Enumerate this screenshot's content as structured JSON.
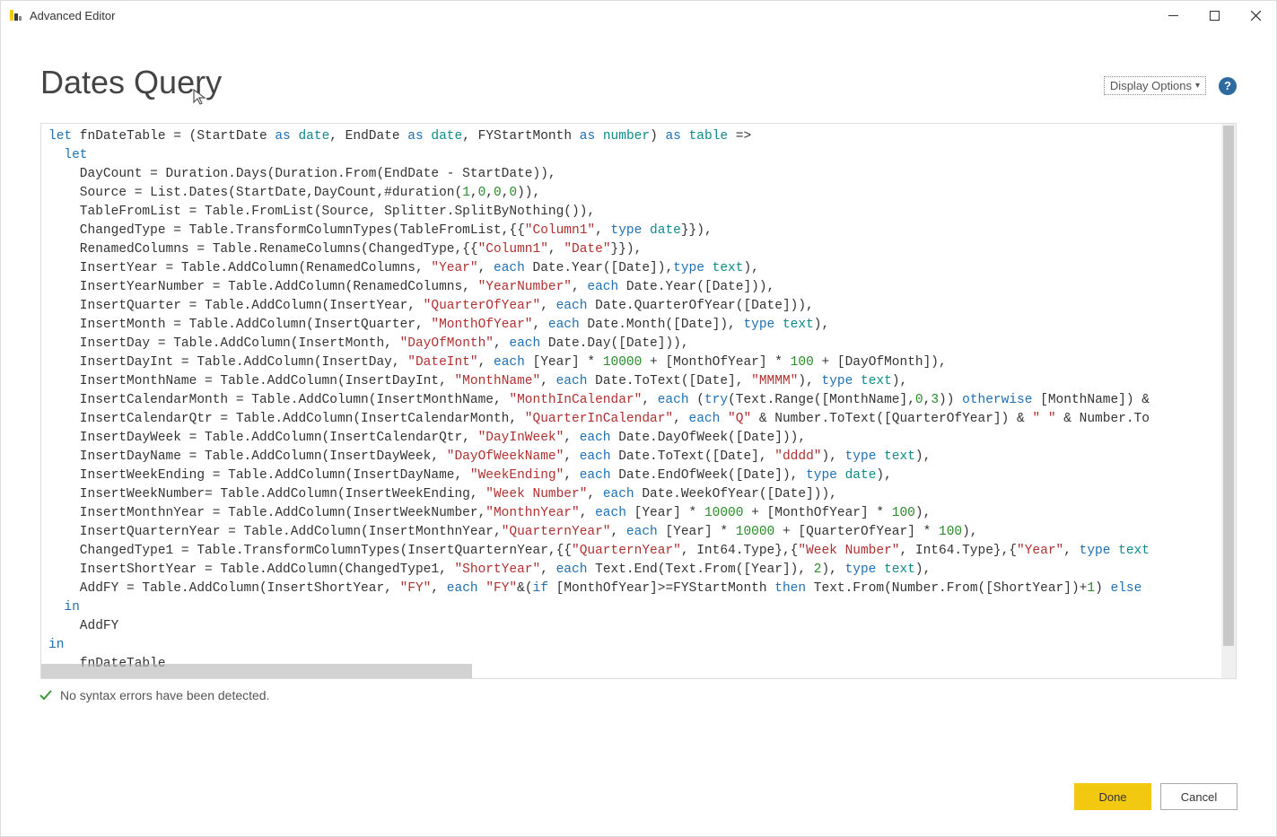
{
  "window": {
    "title": "Advanced Editor",
    "min": "Minimize",
    "max": "Maximize",
    "close": "Close"
  },
  "header": {
    "title": "Dates Query",
    "display_options": "Display Options",
    "help": "?"
  },
  "status": {
    "message": "No syntax errors have been detected."
  },
  "footer": {
    "done": "Done",
    "cancel": "Cancel"
  },
  "code": {
    "lines": [
      [
        [
          "kw",
          "let"
        ],
        [
          "id",
          " fnDateTable = (StartDate "
        ],
        [
          "kw",
          "as"
        ],
        [
          "id",
          " "
        ],
        [
          "ty",
          "date"
        ],
        [
          "id",
          ", EndDate "
        ],
        [
          "kw",
          "as"
        ],
        [
          "id",
          " "
        ],
        [
          "ty",
          "date"
        ],
        [
          "id",
          ", FYStartMonth "
        ],
        [
          "kw",
          "as"
        ],
        [
          "id",
          " "
        ],
        [
          "ty",
          "number"
        ],
        [
          "id",
          ") "
        ],
        [
          "kw",
          "as"
        ],
        [
          "id",
          " "
        ],
        [
          "ty",
          "table"
        ],
        [
          "id",
          " =>"
        ]
      ],
      [
        [
          "id",
          "  "
        ],
        [
          "kw",
          "let"
        ]
      ],
      [
        [
          "id",
          "    DayCount = Duration.Days(Duration.From(EndDate - StartDate)),"
        ]
      ],
      [
        [
          "id",
          "    Source = List.Dates(StartDate,DayCount,#duration("
        ],
        [
          "num",
          "1"
        ],
        [
          "id",
          ","
        ],
        [
          "num",
          "0"
        ],
        [
          "id",
          ","
        ],
        [
          "num",
          "0"
        ],
        [
          "id",
          ","
        ],
        [
          "num",
          "0"
        ],
        [
          "id",
          ")),"
        ]
      ],
      [
        [
          "id",
          "    TableFromList = Table.FromList(Source, Splitter.SplitByNothing()),"
        ]
      ],
      [
        [
          "id",
          "    ChangedType = Table.TransformColumnTypes(TableFromList,{{"
        ],
        [
          "str",
          "\"Column1\""
        ],
        [
          "id",
          ", "
        ],
        [
          "kw",
          "type"
        ],
        [
          "id",
          " "
        ],
        [
          "ty",
          "date"
        ],
        [
          "id",
          "}}),"
        ]
      ],
      [
        [
          "id",
          "    RenamedColumns = Table.RenameColumns(ChangedType,{{"
        ],
        [
          "str",
          "\"Column1\""
        ],
        [
          "id",
          ", "
        ],
        [
          "str",
          "\"Date\""
        ],
        [
          "id",
          "}}),"
        ]
      ],
      [
        [
          "id",
          "    InsertYear = Table.AddColumn(RenamedColumns, "
        ],
        [
          "str",
          "\"Year\""
        ],
        [
          "id",
          ", "
        ],
        [
          "kw",
          "each"
        ],
        [
          "id",
          " Date.Year([Date]),"
        ],
        [
          "kw",
          "type"
        ],
        [
          "id",
          " "
        ],
        [
          "ty",
          "text"
        ],
        [
          "id",
          "),"
        ]
      ],
      [
        [
          "id",
          "    InsertYearNumber = Table.AddColumn(RenamedColumns, "
        ],
        [
          "str",
          "\"YearNumber\""
        ],
        [
          "id",
          ", "
        ],
        [
          "kw",
          "each"
        ],
        [
          "id",
          " Date.Year([Date])),"
        ]
      ],
      [
        [
          "id",
          "    InsertQuarter = Table.AddColumn(InsertYear, "
        ],
        [
          "str",
          "\"QuarterOfYear\""
        ],
        [
          "id",
          ", "
        ],
        [
          "kw",
          "each"
        ],
        [
          "id",
          " Date.QuarterOfYear([Date])),"
        ]
      ],
      [
        [
          "id",
          "    InsertMonth = Table.AddColumn(InsertQuarter, "
        ],
        [
          "str",
          "\"MonthOfYear\""
        ],
        [
          "id",
          ", "
        ],
        [
          "kw",
          "each"
        ],
        [
          "id",
          " Date.Month([Date]), "
        ],
        [
          "kw",
          "type"
        ],
        [
          "id",
          " "
        ],
        [
          "ty",
          "text"
        ],
        [
          "id",
          "),"
        ]
      ],
      [
        [
          "id",
          "    InsertDay = Table.AddColumn(InsertMonth, "
        ],
        [
          "str",
          "\"DayOfMonth\""
        ],
        [
          "id",
          ", "
        ],
        [
          "kw",
          "each"
        ],
        [
          "id",
          " Date.Day([Date])),"
        ]
      ],
      [
        [
          "id",
          "    InsertDayInt = Table.AddColumn(InsertDay, "
        ],
        [
          "str",
          "\"DateInt\""
        ],
        [
          "id",
          ", "
        ],
        [
          "kw",
          "each"
        ],
        [
          "id",
          " [Year] * "
        ],
        [
          "num",
          "10000"
        ],
        [
          "id",
          " + [MonthOfYear] * "
        ],
        [
          "num",
          "100"
        ],
        [
          "id",
          " + [DayOfMonth]),"
        ]
      ],
      [
        [
          "id",
          "    InsertMonthName = Table.AddColumn(InsertDayInt, "
        ],
        [
          "str",
          "\"MonthName\""
        ],
        [
          "id",
          ", "
        ],
        [
          "kw",
          "each"
        ],
        [
          "id",
          " Date.ToText([Date], "
        ],
        [
          "str",
          "\"MMMM\""
        ],
        [
          "id",
          "), "
        ],
        [
          "kw",
          "type"
        ],
        [
          "id",
          " "
        ],
        [
          "ty",
          "text"
        ],
        [
          "id",
          "),"
        ]
      ],
      [
        [
          "id",
          "    InsertCalendarMonth = Table.AddColumn(InsertMonthName, "
        ],
        [
          "str",
          "\"MonthInCalendar\""
        ],
        [
          "id",
          ", "
        ],
        [
          "kw",
          "each"
        ],
        [
          "id",
          " ("
        ],
        [
          "kw",
          "try"
        ],
        [
          "id",
          "(Text.Range([MonthName],"
        ],
        [
          "num",
          "0"
        ],
        [
          "id",
          ","
        ],
        [
          "num",
          "3"
        ],
        [
          "id",
          ")) "
        ],
        [
          "kw",
          "otherwise"
        ],
        [
          "id",
          " [MonthName]) &"
        ]
      ],
      [
        [
          "id",
          "    InsertCalendarQtr = Table.AddColumn(InsertCalendarMonth, "
        ],
        [
          "str",
          "\"QuarterInCalendar\""
        ],
        [
          "id",
          ", "
        ],
        [
          "kw",
          "each"
        ],
        [
          "id",
          " "
        ],
        [
          "str",
          "\"Q\""
        ],
        [
          "id",
          " & Number.ToText([QuarterOfYear]) & "
        ],
        [
          "str",
          "\" \""
        ],
        [
          "id",
          " & Number.To"
        ]
      ],
      [
        [
          "id",
          "    InsertDayWeek = Table.AddColumn(InsertCalendarQtr, "
        ],
        [
          "str",
          "\"DayInWeek\""
        ],
        [
          "id",
          ", "
        ],
        [
          "kw",
          "each"
        ],
        [
          "id",
          " Date.DayOfWeek([Date])),"
        ]
      ],
      [
        [
          "id",
          "    InsertDayName = Table.AddColumn(InsertDayWeek, "
        ],
        [
          "str",
          "\"DayOfWeekName\""
        ],
        [
          "id",
          ", "
        ],
        [
          "kw",
          "each"
        ],
        [
          "id",
          " Date.ToText([Date], "
        ],
        [
          "str",
          "\"dddd\""
        ],
        [
          "id",
          "), "
        ],
        [
          "kw",
          "type"
        ],
        [
          "id",
          " "
        ],
        [
          "ty",
          "text"
        ],
        [
          "id",
          "),"
        ]
      ],
      [
        [
          "id",
          "    InsertWeekEnding = Table.AddColumn(InsertDayName, "
        ],
        [
          "str",
          "\"WeekEnding\""
        ],
        [
          "id",
          ", "
        ],
        [
          "kw",
          "each"
        ],
        [
          "id",
          " Date.EndOfWeek([Date]), "
        ],
        [
          "kw",
          "type"
        ],
        [
          "id",
          " "
        ],
        [
          "ty",
          "date"
        ],
        [
          "id",
          "),"
        ]
      ],
      [
        [
          "id",
          "    InsertWeekNumber= Table.AddColumn(InsertWeekEnding, "
        ],
        [
          "str",
          "\"Week Number\""
        ],
        [
          "id",
          ", "
        ],
        [
          "kw",
          "each"
        ],
        [
          "id",
          " Date.WeekOfYear([Date])),"
        ]
      ],
      [
        [
          "id",
          "    InsertMonthnYear = Table.AddColumn(InsertWeekNumber,"
        ],
        [
          "str",
          "\"MonthnYear\""
        ],
        [
          "id",
          ", "
        ],
        [
          "kw",
          "each"
        ],
        [
          "id",
          " [Year] * "
        ],
        [
          "num",
          "10000"
        ],
        [
          "id",
          " + [MonthOfYear] * "
        ],
        [
          "num",
          "100"
        ],
        [
          "id",
          "),"
        ]
      ],
      [
        [
          "id",
          "    InsertQuarternYear = Table.AddColumn(InsertMonthnYear,"
        ],
        [
          "str",
          "\"QuarternYear\""
        ],
        [
          "id",
          ", "
        ],
        [
          "kw",
          "each"
        ],
        [
          "id",
          " [Year] * "
        ],
        [
          "num",
          "10000"
        ],
        [
          "id",
          " + [QuarterOfYear] * "
        ],
        [
          "num",
          "100"
        ],
        [
          "id",
          "),"
        ]
      ],
      [
        [
          "id",
          "    ChangedType1 = Table.TransformColumnTypes(InsertQuarternYear,{{"
        ],
        [
          "str",
          "\"QuarternYear\""
        ],
        [
          "id",
          ", Int64.Type},{"
        ],
        [
          "str",
          "\"Week Number\""
        ],
        [
          "id",
          ", Int64.Type},{"
        ],
        [
          "str",
          "\"Year\""
        ],
        [
          "id",
          ", "
        ],
        [
          "kw",
          "type"
        ],
        [
          "id",
          " "
        ],
        [
          "ty",
          "text"
        ]
      ],
      [
        [
          "id",
          "    InsertShortYear = Table.AddColumn(ChangedType1, "
        ],
        [
          "str",
          "\"ShortYear\""
        ],
        [
          "id",
          ", "
        ],
        [
          "kw",
          "each"
        ],
        [
          "id",
          " Text.End(Text.From([Year]), "
        ],
        [
          "num",
          "2"
        ],
        [
          "id",
          "), "
        ],
        [
          "kw",
          "type"
        ],
        [
          "id",
          " "
        ],
        [
          "ty",
          "text"
        ],
        [
          "id",
          "),"
        ]
      ],
      [
        [
          "id",
          "    AddFY = Table.AddColumn(InsertShortYear, "
        ],
        [
          "str",
          "\"FY\""
        ],
        [
          "id",
          ", "
        ],
        [
          "kw",
          "each"
        ],
        [
          "id",
          " "
        ],
        [
          "str",
          "\"FY\""
        ],
        [
          "id",
          "&("
        ],
        [
          "kw",
          "if"
        ],
        [
          "id",
          " [MonthOfYear]>=FYStartMonth "
        ],
        [
          "kw",
          "then"
        ],
        [
          "id",
          " Text.From(Number.From([ShortYear])+"
        ],
        [
          "num",
          "1"
        ],
        [
          "id",
          ") "
        ],
        [
          "kw",
          "else"
        ]
      ],
      [
        [
          "id",
          "  "
        ],
        [
          "kw",
          "in"
        ]
      ],
      [
        [
          "id",
          "    AddFY"
        ]
      ],
      [
        [
          "kw",
          "in"
        ]
      ],
      [
        [
          "id",
          "    fnDateTable"
        ]
      ]
    ]
  }
}
